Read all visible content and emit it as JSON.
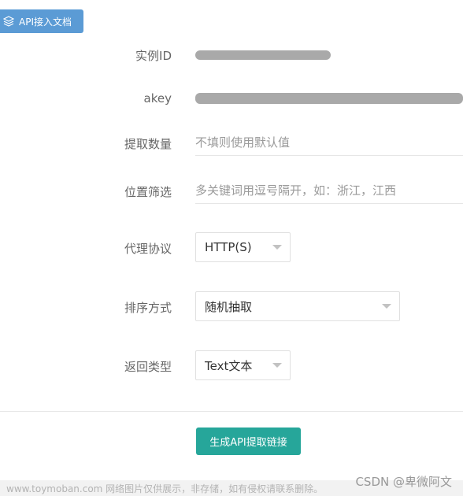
{
  "doc_button": {
    "label": "API接入文档",
    "icon": "layers-icon"
  },
  "form": {
    "instance_id": {
      "label": "实例ID"
    },
    "akey": {
      "label": "akey"
    },
    "count": {
      "label": "提取数量",
      "placeholder": "不填则使用默认值"
    },
    "location": {
      "label": "位置筛选",
      "placeholder": "多关键词用逗号隔开，如：浙江，江西"
    },
    "protocol": {
      "label": "代理协议",
      "value": "HTTP(S)"
    },
    "sort": {
      "label": "排序方式",
      "value": "随机抽取"
    },
    "return_type": {
      "label": "返回类型",
      "value": "Text文本"
    }
  },
  "generate_button": {
    "label": "生成API提取链接",
    "color": "#26a69a"
  },
  "watermark": {
    "left": "www.toymoban.com 网络图片仅供展示，非存储，如有侵权请联系删除。",
    "right": "CSDN @卑微阿文"
  },
  "colors": {
    "accent_blue": "#5b9bd5",
    "accent_green": "#26a69a"
  }
}
